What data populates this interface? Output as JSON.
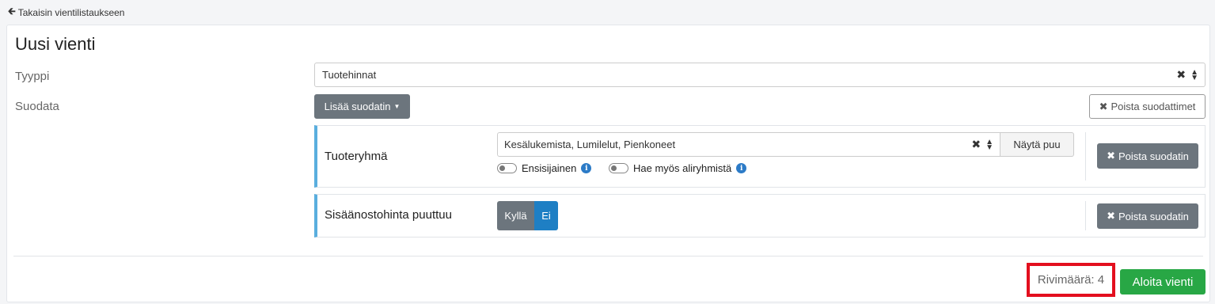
{
  "nav": {
    "back_icon": "arrow-left-icon",
    "back_label": "Takaisin vientilistaukseen"
  },
  "form": {
    "title": "Uusi vienti",
    "type_label": "Tyyppi",
    "type_value": "Tuotehinnat",
    "filter_label": "Suodata",
    "add_filter_label": "Lisää suodatin",
    "clear_filters_label": "Poista suodattimet"
  },
  "filters": [
    {
      "label": "Tuoteryhmä",
      "value": "Kesälukemista, Lumilelut, Pienkoneet",
      "tree_button": "Näytä puu",
      "toggles": [
        {
          "label": "Ensisijainen",
          "on": false
        },
        {
          "label": "Hae myös aliryhmistä",
          "on": false
        }
      ],
      "remove_label": "Poista suodatin"
    },
    {
      "label": "Sisäänostohinta puuttuu",
      "options": [
        "Kyllä",
        "Ei"
      ],
      "selected": "Ei",
      "remove_label": "Poista suodatin"
    }
  ],
  "footer": {
    "row_count": "Rivimäärä: 4",
    "start_label": "Aloita vienti"
  },
  "colors": {
    "accent_blue": "#1e7fc4",
    "panel_border": "#5aaede",
    "success_green": "#28a745",
    "highlight_red": "#e30f1e"
  }
}
